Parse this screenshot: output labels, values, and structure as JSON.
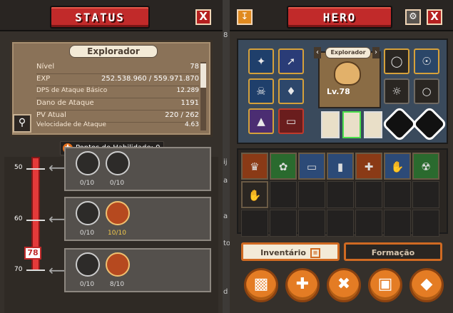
{
  "status_panel": {
    "title": "STATUS",
    "close_label": "X",
    "stats_header": "Explorador",
    "stats": [
      {
        "label": "Nível",
        "value": "78"
      },
      {
        "label": "EXP",
        "value": "252.538.960 / 559.971.870"
      },
      {
        "label": "DPS de Ataque Básico",
        "value": "12.289"
      },
      {
        "label": "Dano de Ataque",
        "value": "1191"
      },
      {
        "label": "PV Atual",
        "value": "220 / 262"
      },
      {
        "label": "Velocidade de Ataque",
        "value": "4.63"
      }
    ],
    "search_icon": "magnifier-icon",
    "skill_points_label": "Pontos de Habilidade: 0",
    "levels": [
      "50",
      "60",
      "70"
    ],
    "current_level": "78",
    "skill_rows": [
      {
        "skills": [
          {
            "icon": "boots-skill-icon",
            "count": "0/10",
            "active": false
          },
          {
            "icon": "spiral-skill-icon",
            "count": "0/10",
            "active": false
          }
        ]
      },
      {
        "skills": [
          {
            "icon": "crescent-skill-icon",
            "count": "0/10",
            "active": false
          },
          {
            "icon": "fire-swirl-skill-icon",
            "count": "10/10",
            "active": true
          }
        ]
      },
      {
        "skills": [
          {
            "icon": "wing-skill-icon",
            "count": "0/10",
            "active": false
          },
          {
            "icon": "slash-skill-icon",
            "count": "8/10",
            "active": true
          }
        ]
      }
    ]
  },
  "gap_labels": [
    "8",
    "ij",
    "a",
    "a",
    "to",
    "d"
  ],
  "hero_panel": {
    "title": "HERO",
    "close_label": "X",
    "hero_name": "Explorador",
    "hero_level": "Lv.78",
    "bottom_tabs": [
      {
        "label": "Inventário",
        "active": true
      },
      {
        "label": "Formação",
        "active": false
      }
    ],
    "bottom_buttons": [
      "chest-icon",
      "cross-icon",
      "rune-icon",
      "box-icon",
      "gem-icon"
    ]
  },
  "colors": {
    "title_red": "#c12a2a",
    "accent_orange": "#e47c24",
    "panel_bg": "#35302b",
    "level_bar": "#e33a3a"
  }
}
